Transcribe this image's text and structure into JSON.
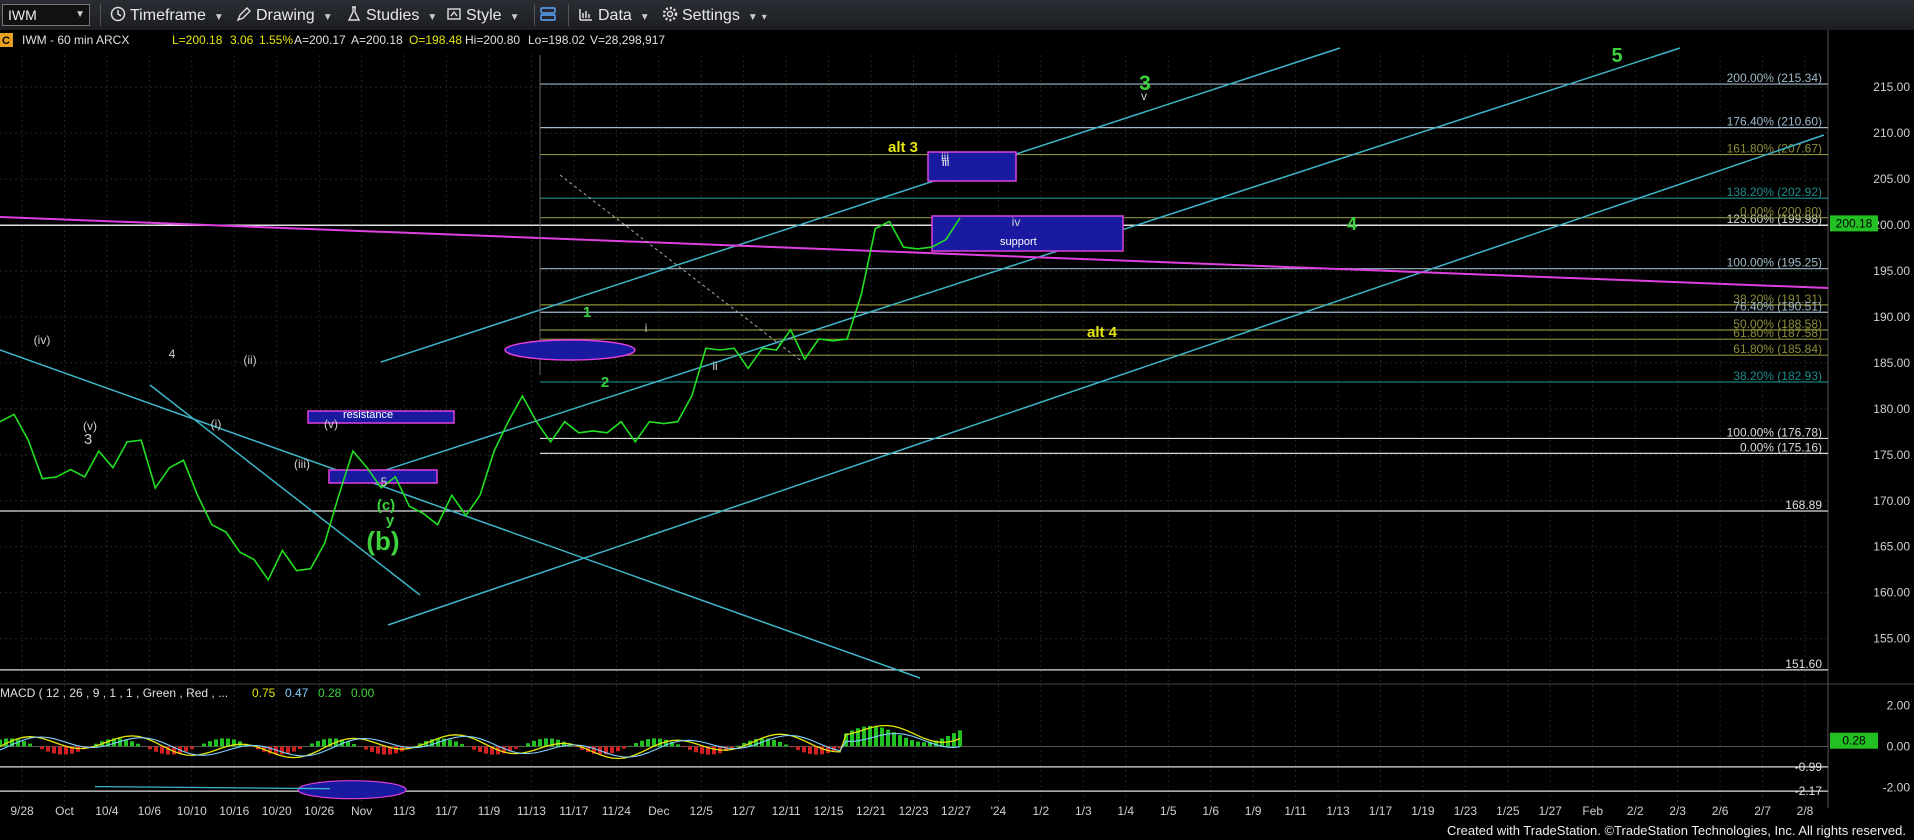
{
  "toolbar": {
    "symbol": "IWM",
    "timeframe": "Timeframe",
    "drawing": "Drawing",
    "studies": "Studies",
    "style": "Style",
    "data": "Data",
    "settings": "Settings"
  },
  "header": {
    "badge": "C",
    "symbol_info": "IWM - 60 min  ARCX",
    "last": "L=200.18",
    "change": "3.06",
    "change_pct": "1.55%",
    "ask": "A=200.17",
    "ask2": "A=200.18",
    "open": "O=198.48",
    "high": "Hi=200.80",
    "low": "Lo=198.02",
    "volume": "V=28,298,917"
  },
  "footer": "Created with TradeStation. ©TradeStation Technologies, Inc. All rights reserved.",
  "chart_data": {
    "type": "line",
    "symbol": "IWM",
    "interval": "60 min",
    "ylim": [
      150.5,
      218.5
    ],
    "y_ticks": [
      "215.00",
      "210.00",
      "205.00",
      "200.00",
      "195.00",
      "190.00",
      "185.00",
      "180.00",
      "175.00",
      "170.00",
      "165.00",
      "160.00",
      "155.00"
    ],
    "x_ticks": [
      "9/28",
      "Oct",
      "10/4",
      "10/6",
      "10/10",
      "10/16",
      "10/20",
      "10/26",
      "Nov",
      "11/3",
      "11/7",
      "11/9",
      "11/13",
      "11/17",
      "11/24",
      "Dec",
      "12/5",
      "12/7",
      "12/11",
      "12/15",
      "12/21",
      "12/23",
      "12/27",
      "'24",
      "1/2",
      "1/3",
      "1/4",
      "1/5",
      "1/6",
      "1/9",
      "1/11",
      "1/13",
      "1/17",
      "1/19",
      "1/23",
      "1/25",
      "1/27",
      "Feb",
      "2/2",
      "2/3",
      "2/6",
      "2/7",
      "2/8"
    ],
    "last_price": "200.18",
    "price_series": [
      178,
      180,
      176,
      173,
      172,
      174,
      172,
      176,
      173,
      177,
      176,
      172,
      173,
      175,
      170,
      168,
      166,
      165,
      163,
      162,
      164,
      163,
      162,
      166,
      170,
      176,
      173,
      172,
      172,
      170,
      168,
      168,
      170,
      169,
      170,
      176,
      178,
      182,
      178,
      177,
      178,
      178,
      177,
      178,
      178,
      177,
      178,
      179,
      178,
      182,
      186,
      187,
      186,
      185,
      186,
      187,
      188,
      186,
      187,
      188,
      187,
      193,
      199,
      201,
      197,
      198,
      197,
      199,
      200.18
    ],
    "fib_levels": [
      {
        "label": "200.00% (215.34)",
        "value": 215.34,
        "color": "#9fb8c8"
      },
      {
        "label": "176.40% (210.60)",
        "value": 210.6,
        "color": "#9fb8c8"
      },
      {
        "label": "161.80% (207.67)",
        "value": 207.67,
        "color": "#8d8d3a"
      },
      {
        "label": "138.20% (202.92)",
        "value": 202.92,
        "color": "#1e8c8c"
      },
      {
        "label": "123.60% (199.98)",
        "value": 199.98,
        "color": "#d9d9d9"
      },
      {
        "label": "0.00% (200.80)",
        "value": 200.8,
        "color": "#8d8d3a"
      },
      {
        "label": "100.00% (195.25)",
        "value": 195.25,
        "color": "#9fb8c8"
      },
      {
        "label": "38.20% (191.31)",
        "value": 191.31,
        "color": "#8d8d3a"
      },
      {
        "label": "76.40% (190.51)",
        "value": 190.51,
        "color": "#9fb8c8"
      },
      {
        "label": "50.00% (188.58)",
        "value": 188.58,
        "color": "#8d8d3a"
      },
      {
        "label": "61.80% (187.58)",
        "value": 187.58,
        "color": "#8d8d3a"
      },
      {
        "label": "61.80% (185.84)",
        "value": 185.84,
        "color": "#8d8d3a"
      },
      {
        "label": "38.20% (182.93)",
        "value": 182.93,
        "color": "#1e8c8c"
      },
      {
        "label": "100.00% (176.78)",
        "value": 176.78,
        "color": "#d9d9d9"
      },
      {
        "label": "0.00% (175.16)",
        "value": 175.16,
        "color": "#d9d9d9"
      }
    ],
    "extra_levels": [
      {
        "label": "168.89",
        "value": 168.89
      },
      {
        "label": "151.60",
        "value": 151.6
      }
    ],
    "wave_labels": [
      {
        "text": "(iv)",
        "color": "#d0d0d0"
      },
      {
        "text": "(v)",
        "color": "#d0d0d0"
      },
      {
        "text": "3",
        "color": "#d0d0d0"
      },
      {
        "text": "4",
        "color": "#d0d0d0"
      },
      {
        "text": "(i)",
        "color": "#d0d0d0"
      },
      {
        "text": "(ii)",
        "color": "#d0d0d0"
      },
      {
        "text": "(iii)",
        "color": "#d0d0d0"
      },
      {
        "text": "(v)",
        "color": "#d0d0d0"
      },
      {
        "text": "5",
        "color": "#d0d0d0"
      },
      {
        "text": "(c)",
        "color": "#3ed13e"
      },
      {
        "text": "y",
        "color": "#3ed13e"
      },
      {
        "text": "(b)",
        "color": "#3ed13e"
      },
      {
        "text": "1",
        "color": "#3ed13e"
      },
      {
        "text": "2",
        "color": "#3ed13e"
      },
      {
        "text": "i",
        "color": "#d0d0d0"
      },
      {
        "text": "ii",
        "color": "#d0d0d0"
      },
      {
        "text": "iii",
        "color": "#d0d0d0"
      },
      {
        "text": "iv",
        "color": "#d0d0d0"
      },
      {
        "text": "v",
        "color": "#d0d0d0"
      },
      {
        "text": "alt 3",
        "color": "#e5e510"
      },
      {
        "text": "alt 4",
        "color": "#e5e510"
      },
      {
        "text": "3",
        "color": "#3ed13e"
      },
      {
        "text": "4",
        "color": "#3ed13e"
      },
      {
        "text": "5",
        "color": "#3ed13e"
      }
    ],
    "boxes": [
      {
        "label": "resistance"
      },
      {
        "label": "support"
      },
      {
        "label": "iii"
      }
    ],
    "macd": {
      "title": "MACD ( 12 , 26 , 9 , 1 , 1 , Green , Red , ...",
      "values": [
        "0.75",
        "0.47",
        "0.28",
        "0.00"
      ],
      "value_colors": [
        "#e5e510",
        "#7fd0ff",
        "#3ed13e",
        "#3ed13e"
      ],
      "ylim": [
        -2.6,
        2.5
      ],
      "y_ticks": [
        "2.00",
        "0.00",
        "-2.00"
      ],
      "level_labels": [
        "-0.99",
        "-2.17"
      ],
      "current": "0.28"
    }
  }
}
